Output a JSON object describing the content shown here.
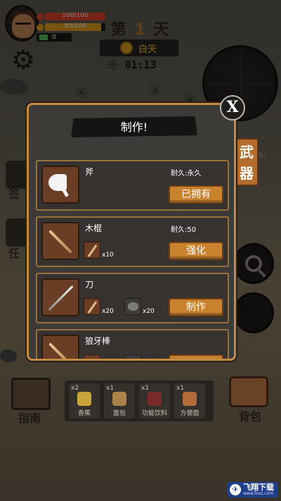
{
  "hud": {
    "health_text": "100/100",
    "hunger_text": "93/100",
    "money_text": "0",
    "health_fraction": 1.0,
    "hunger_fraction": 0.93,
    "health_color": "#e2452f",
    "hunger_color": "#e7a21f"
  },
  "day": {
    "prefix": "第",
    "number": "1",
    "suffix": "天",
    "phase": "白天",
    "timer": "01:13"
  },
  "side_menu": {
    "item1_label": "签",
    "item2_label": "任"
  },
  "weapon_tab": {
    "line1": "武",
    "line2": "器"
  },
  "weapon_tab_hint": "B。",
  "modal": {
    "title": "制作!",
    "close_label": "X",
    "items": [
      {
        "name": "斧",
        "durability": "耐久:永久",
        "action": "已拥有",
        "icon": "axe-icon"
      },
      {
        "name": "木棍",
        "durability": "耐久:50",
        "action": "强化",
        "icon": "stick-icon",
        "materials": [
          {
            "icon": "wood-stick-icon",
            "qty": "x10"
          }
        ]
      },
      {
        "name": "刀",
        "action": "制作",
        "icon": "knife-icon",
        "materials": [
          {
            "icon": "wood-stick-icon",
            "qty": "x20"
          },
          {
            "icon": "stone-icon",
            "qty": "x20"
          }
        ]
      },
      {
        "name": "狼牙棒",
        "icon": "mace-icon"
      }
    ]
  },
  "bottom": {
    "guide_label": "指南",
    "bag_label": "背包",
    "quick_slots": [
      {
        "count": "x2",
        "name": "香蕉"
      },
      {
        "count": "x1",
        "name": "面包"
      },
      {
        "count": "x1",
        "name": "功能饮料"
      },
      {
        "count": "x1",
        "name": "方便面"
      }
    ]
  },
  "watermark": {
    "title": "飞翔下载",
    "url": "www.fxxz.com"
  }
}
